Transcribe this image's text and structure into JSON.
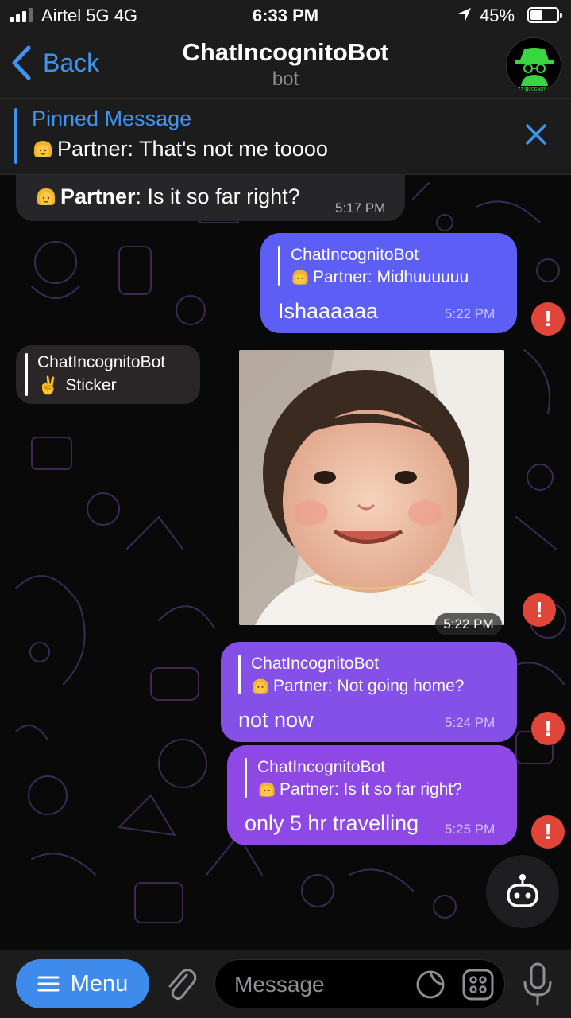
{
  "status_bar": {
    "carrier": "Airtel 5G  4G",
    "time": "6:33 PM",
    "battery": "45%",
    "battery_level": 0.45,
    "signal_bars": 3
  },
  "nav": {
    "back_label": "Back",
    "title": "ChatIncognitoBot",
    "subtitle": "bot",
    "avatar_icon": "incognito-bot-logo-icon",
    "avatar_text": "CHAT INCOGNITO BOT"
  },
  "pinned": {
    "title": "Pinned Message",
    "text": "Partner: That's not me toooo",
    "emoji": "person-emoji-icon"
  },
  "messages": {
    "m1": {
      "sender": "Partner",
      "text": ": Is it so far right?",
      "time": "5:17 PM"
    },
    "m2": {
      "reply_name": "ChatIncognitoBot",
      "reply_text": "Partner: Midhuuuuuu",
      "text": "Ishaaaaaa",
      "time": "5:22 PM"
    },
    "m3": {
      "reply_name": "ChatIncognitoBot",
      "reply_text": "Sticker",
      "reply_emoji": "✌️",
      "time": "5:22 PM"
    },
    "m4": {
      "reply_name": "ChatIncognitoBot",
      "reply_text": "Partner: Not going home?",
      "text": "not now",
      "time": "5:24 PM"
    },
    "m5": {
      "reply_name": "ChatIncognitoBot",
      "reply_text": "Partner: Is it so far right?",
      "text": "only 5 hr travelling",
      "time": "5:25 PM"
    },
    "error_mark": "!"
  },
  "input_bar": {
    "menu_label": "Menu",
    "placeholder": "Message"
  },
  "colors": {
    "accent": "#3e95f0",
    "bubble_out_top": "#5a5ff5",
    "bubble_out_bottom": "#8b49e6",
    "error": "#e0453a"
  }
}
